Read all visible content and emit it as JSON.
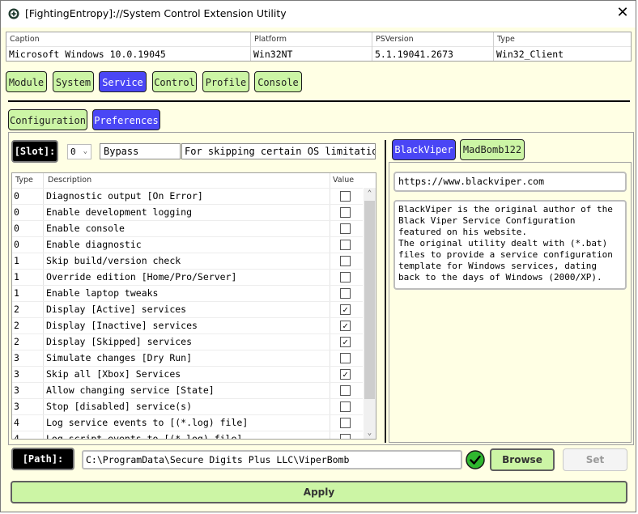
{
  "window": {
    "title": "[FightingEntropy]://System Control Extension Utility",
    "icon": "fightingentropy-logo-icon",
    "close_label": "✕"
  },
  "system_info": {
    "columns": [
      "Caption",
      "Platform",
      "PSVersion",
      "Type"
    ],
    "values": [
      "Microsoft Windows 10.0.19045",
      "Win32NT",
      "5.1.19041.2673",
      "Win32_Client"
    ]
  },
  "main_tabs": [
    {
      "label": "Module",
      "active": false
    },
    {
      "label": "System",
      "active": false
    },
    {
      "label": "Service",
      "active": true
    },
    {
      "label": "Control",
      "active": false
    },
    {
      "label": "Profile",
      "active": false
    },
    {
      "label": "Console",
      "active": false
    }
  ],
  "sub_tabs": [
    {
      "label": "Configuration",
      "active": false
    },
    {
      "label": "Preferences",
      "active": true
    }
  ],
  "slot": {
    "label": "[Slot]:",
    "selected": "0",
    "name": "Bypass",
    "description": "For skipping certain OS limitations"
  },
  "preferences_grid": {
    "headers": [
      "Type",
      "Description",
      "Value"
    ],
    "rows": [
      {
        "type": "0",
        "description": "Diagnostic output [On Error]",
        "checked": false
      },
      {
        "type": "0",
        "description": "Enable development logging",
        "checked": false
      },
      {
        "type": "0",
        "description": "Enable console",
        "checked": false
      },
      {
        "type": "0",
        "description": "Enable diagnostic",
        "checked": false
      },
      {
        "type": "1",
        "description": "Skip build/version check",
        "checked": false
      },
      {
        "type": "1",
        "description": "Override edition [Home/Pro/Server]",
        "checked": false
      },
      {
        "type": "1",
        "description": "Enable laptop tweaks",
        "checked": false
      },
      {
        "type": "2",
        "description": "Display [Active] services",
        "checked": true
      },
      {
        "type": "2",
        "description": "Display [Inactive] services",
        "checked": true
      },
      {
        "type": "2",
        "description": "Display [Skipped] services",
        "checked": true
      },
      {
        "type": "3",
        "description": "Simulate changes [Dry Run]",
        "checked": false
      },
      {
        "type": "3",
        "description": "Skip all [Xbox] Services",
        "checked": true
      },
      {
        "type": "3",
        "description": "Allow changing service [State]",
        "checked": false
      },
      {
        "type": "3",
        "description": "Stop [disabled] service(s)",
        "checked": false
      },
      {
        "type": "4",
        "description": "Log service events to [(*.log) file]",
        "checked": false
      },
      {
        "type": "4",
        "description": "Log script events to [(*.log) file]",
        "checked": false
      }
    ]
  },
  "author_tabs": [
    {
      "label": "BlackViper",
      "active": true
    },
    {
      "label": "MadBomb122",
      "active": false
    }
  ],
  "author": {
    "url": "https://www.blackviper.com",
    "description": "BlackViper is the original author of the\nBlack Viper Service Configuration\nfeatured on his website.\nThe original utility dealt with (*.bat)\nfiles to provide a service configuration\ntemplate for Windows services, dating\nback to the days of Windows (2000/XP)."
  },
  "path": {
    "label": "[Path]:",
    "value": "C:\\ProgramData\\Secure Digits Plus LLC\\ViperBomb",
    "status_icon": "check-circle-icon",
    "browse_label": "Browse",
    "set_label": "Set"
  },
  "apply_label": "Apply",
  "colors": {
    "background": "#ffffe4",
    "button_green": "#ccf5a5",
    "active_blue": "#4a46f5",
    "label_black": "#000000",
    "status_green": "#2fb82f"
  }
}
